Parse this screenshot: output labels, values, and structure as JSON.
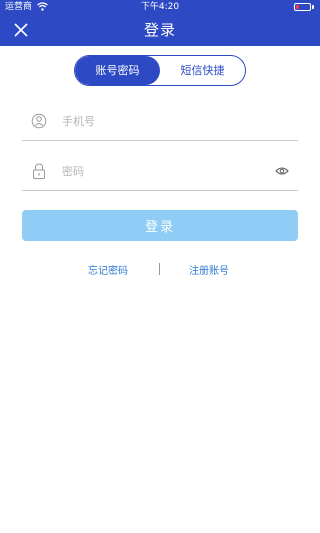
{
  "status_bar": {
    "carrier": "运营商",
    "time": "下午4:20",
    "wifi_icon": "wifi-icon",
    "battery_icon": "battery-low-icon",
    "battery_color": "#ff3b30"
  },
  "nav": {
    "title": "登录",
    "close_icon": "close-icon",
    "background": "#2d4ac4"
  },
  "login_mode": {
    "options": [
      "账号密码",
      "短信快捷"
    ],
    "selected": "账号密码"
  },
  "form": {
    "phone": {
      "placeholder": "手机号",
      "value": "",
      "icon": "user-icon"
    },
    "password": {
      "placeholder": "密码",
      "value": "",
      "icon": "lock-icon",
      "toggle_icon": "eye-icon"
    },
    "submit_label": "登录",
    "submit_color": "#8fcdf6"
  },
  "links": {
    "forgot_password": "忘记密码",
    "register": "注册账号",
    "color": "#2d7bd0"
  }
}
